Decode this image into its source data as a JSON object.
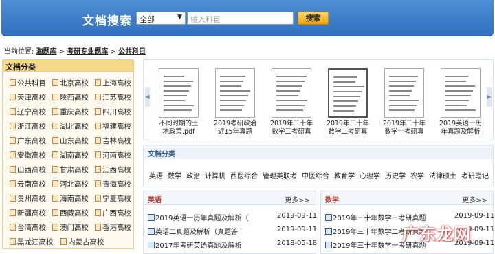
{
  "header": {
    "title": "文档搜索",
    "select_value": "全部",
    "search_placeholder": "输入科目",
    "search_button": "搜索"
  },
  "breadcrumb": {
    "prefix": "当前位置:",
    "items": [
      "淘题库",
      "考研专业题库",
      "公共科目"
    ]
  },
  "sidebar": {
    "title": "文档分类",
    "items": [
      "公共科目",
      "北京高校",
      "上海高校",
      "天津高校",
      "陕西高校",
      "江苏高校",
      "辽宁高校",
      "重庆高校",
      "四川高校",
      "浙江高校",
      "湖北高校",
      "福建高校",
      "广东高校",
      "山东高校",
      "吉林高校",
      "安徽高校",
      "湖南高校",
      "河南高校",
      "山西高校",
      "甘肃高校",
      "江西高校",
      "云南高校",
      "河北高校",
      "青海高校",
      "贵州高校",
      "海南高校",
      "宁夏高校",
      "新疆高校",
      "西藏高校",
      "广西高校",
      "台湾高校",
      "澳门高校",
      "香港高校",
      "黑龙江高校",
      "内蒙古高校"
    ]
  },
  "carousel": {
    "docs": [
      {
        "line1": "不同时期的土",
        "line2": "地政策.pdf"
      },
      {
        "line1": "2019考研政治",
        "line2": "近15年真题"
      },
      {
        "line1": "2019年三十年",
        "line2": "数学三考研真"
      },
      {
        "line1": "2019年三十年",
        "line2": "数学二考研真"
      },
      {
        "line1": "2019年三十年",
        "line2": "数学一考研真"
      },
      {
        "line1": "2019英语一历",
        "line2": "年真题及解析"
      }
    ]
  },
  "doc_categories": {
    "title": "文档分类",
    "tags": [
      "英语",
      "数学",
      "政治",
      "计算机",
      "西医综合",
      "管理类联考",
      "中医综合",
      "教育学",
      "心理学",
      "历史学",
      "农学",
      "法律硕士",
      "考研笔记"
    ]
  },
  "english": {
    "title": "英语",
    "more": "更多>>",
    "rows": [
      {
        "name": "2019英语一历年真题及解析（",
        "date": "2019-09-11"
      },
      {
        "name": "英语二真题及解析（真题答",
        "date": "2019-09-11"
      },
      {
        "name": "2017年考研英语真题及解析",
        "date": "2018-05-18"
      }
    ]
  },
  "math": {
    "title": "数学",
    "more": "更多>>",
    "rows": [
      {
        "name": "2019年三十年数学三考研真题",
        "date": "2019-09-11"
      },
      {
        "name": "2019年三十年数学二考研真题",
        "date": "2019-09-11"
      },
      {
        "name": "2019年三十年数学一考研真题",
        "date": "2019-09-11"
      }
    ]
  },
  "watermark": "广东龙网"
}
